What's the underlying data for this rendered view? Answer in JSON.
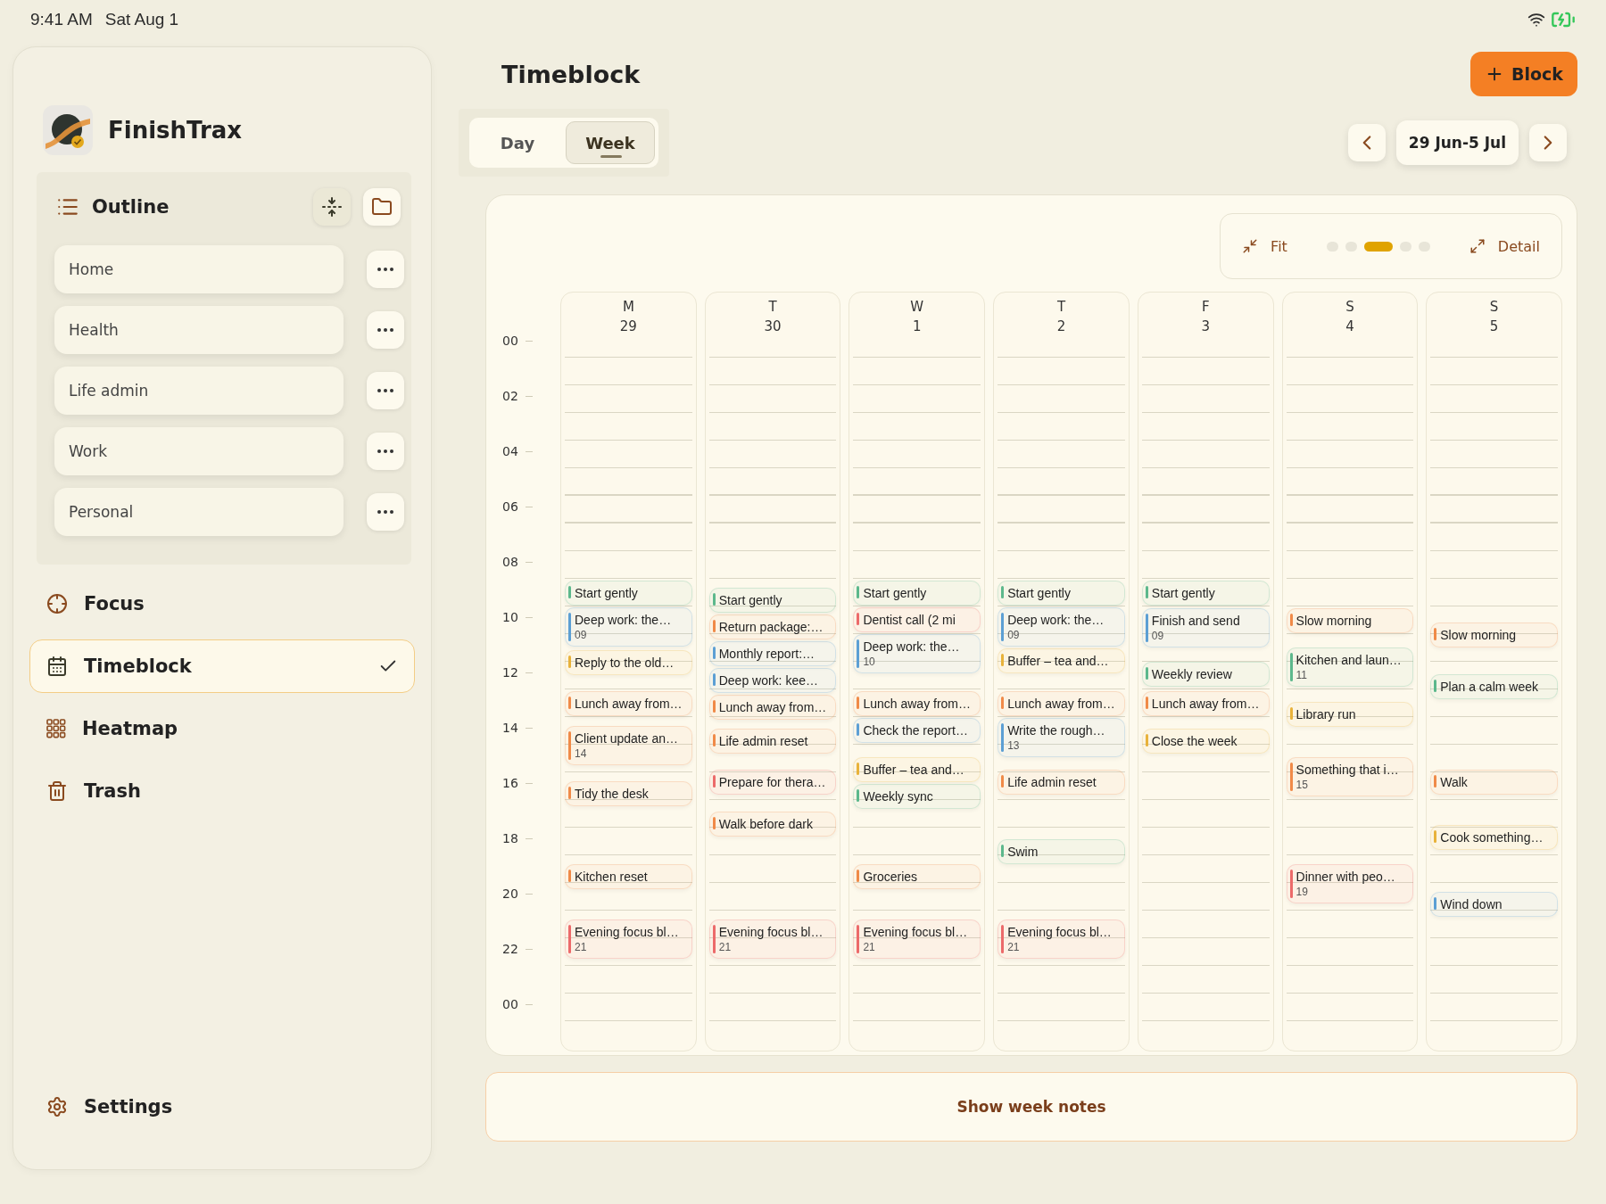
{
  "status_bar": {
    "time": "9:41 AM",
    "date": "Sat Aug 1"
  },
  "sidebar": {
    "app_name": "FinishTrax",
    "outline": {
      "title": "Outline",
      "items": [
        {
          "label": "Home"
        },
        {
          "label": "Health"
        },
        {
          "label": "Life admin"
        },
        {
          "label": "Work"
        },
        {
          "label": "Personal"
        }
      ]
    },
    "nav": [
      {
        "kind": "focus",
        "label": "Focus",
        "selected": false
      },
      {
        "kind": "timeblock",
        "label": "Timeblock",
        "selected": true
      },
      {
        "kind": "heatmap",
        "label": "Heatmap",
        "selected": false
      },
      {
        "kind": "trash",
        "label": "Trash",
        "selected": false
      }
    ],
    "settings": {
      "label": "Settings"
    }
  },
  "header": {
    "title": "Timeblock",
    "add_button": "Block"
  },
  "view_tabs": [
    {
      "label": "Day",
      "selected": false
    },
    {
      "label": "Week",
      "selected": true
    }
  ],
  "date_range": "29 Jun-5 Jul",
  "zoom": {
    "fit_label": "Fit",
    "detail_label": "Detail",
    "steps": [
      {
        "selected": false
      },
      {
        "selected": false
      },
      {
        "selected": true
      },
      {
        "selected": false
      },
      {
        "selected": false
      }
    ]
  },
  "hour_labels": [
    "00",
    "02",
    "04",
    "06",
    "08",
    "10",
    "12",
    "14",
    "16",
    "18",
    "20",
    "22",
    "00"
  ],
  "days": [
    {
      "letter": "M",
      "number": "29",
      "events": [
        {
          "title": "Start gently",
          "color": "#5cb88c"
        },
        {
          "title": "Deep work: the…",
          "sub": "09",
          "color": "#5c9fd4"
        },
        {
          "title": "Reply to the old…",
          "color": "#e8b23a"
        },
        {
          "title": "Lunch away from…",
          "color": "#f08a48"
        },
        {
          "title": "Client update an…",
          "sub": "14",
          "color": "#f08a48"
        },
        {
          "title": "Tidy the desk",
          "color": "#f08a48"
        },
        {
          "title": "Kitchen reset",
          "color": "#f08a48"
        },
        {
          "title": "Evening focus bl…",
          "sub": "21",
          "color": "#ec6a6a"
        }
      ]
    },
    {
      "letter": "T",
      "number": "30",
      "events": [
        {
          "title": "Start gently",
          "color": "#5cb88c"
        },
        {
          "title": "Return package:…",
          "color": "#f08a48"
        },
        {
          "title": "Monthly report:…",
          "color": "#5c9fd4"
        },
        {
          "title": "Deep work: kee…",
          "color": "#5c9fd4"
        },
        {
          "title": "Lunch away from…",
          "color": "#f08a48"
        },
        {
          "title": "Life admin reset",
          "color": "#f08a48"
        },
        {
          "title": "Prepare for thera…",
          "color": "#ec6a6a"
        },
        {
          "title": "Walk before dark",
          "color": "#f08a48"
        },
        {
          "title": "Evening focus bl…",
          "sub": "21",
          "color": "#ec6a6a"
        }
      ]
    },
    {
      "letter": "W",
      "number": "1",
      "events": [
        {
          "title": "Start gently",
          "color": "#5cb88c"
        },
        {
          "title": "Dentist call (2 mi",
          "color": "#ec6a6a"
        },
        {
          "title": "Deep work: the…",
          "sub": "10",
          "color": "#5c9fd4"
        },
        {
          "title": "Lunch away from…",
          "color": "#f08a48"
        },
        {
          "title": "Check the report…",
          "color": "#5c9fd4"
        },
        {
          "title": "Buffer – tea and…",
          "color": "#e8b23a"
        },
        {
          "title": "Weekly sync",
          "color": "#5cb88c"
        },
        {
          "title": "Groceries",
          "color": "#f08a48"
        },
        {
          "title": "Evening focus bl…",
          "sub": "21",
          "color": "#ec6a6a"
        }
      ]
    },
    {
      "letter": "T",
      "number": "2",
      "events": [
        {
          "title": "Start gently",
          "color": "#5cb88c"
        },
        {
          "title": "Deep work: the…",
          "sub": "09",
          "color": "#5c9fd4"
        },
        {
          "title": "Buffer – tea and…",
          "color": "#e8b23a"
        },
        {
          "title": "Lunch away from…",
          "color": "#f08a48"
        },
        {
          "title": "Write the rough…",
          "sub": "13",
          "color": "#5c9fd4"
        },
        {
          "title": "Life admin reset",
          "color": "#f08a48"
        },
        {
          "title": "Swim",
          "color": "#5cb88c"
        },
        {
          "title": "Evening focus bl…",
          "sub": "21",
          "color": "#ec6a6a"
        }
      ]
    },
    {
      "letter": "F",
      "number": "3",
      "events": [
        {
          "title": "Start gently",
          "color": "#5cb88c"
        },
        {
          "title": "Finish and send",
          "sub": "09",
          "color": "#5c9fd4"
        },
        {
          "title": "Weekly review",
          "color": "#5cb88c"
        },
        {
          "title": "Lunch away from…",
          "color": "#f08a48"
        },
        {
          "title": "Close the week",
          "color": "#e8b23a"
        }
      ]
    },
    {
      "letter": "S",
      "number": "4",
      "events": [
        {
          "title": "Slow morning",
          "color": "#f08a48"
        },
        {
          "title": "Kitchen and laun…",
          "sub": "11",
          "color": "#5cb88c"
        },
        {
          "title": "Library run",
          "color": "#e8b23a"
        },
        {
          "title": "Something that i…",
          "sub": "15",
          "color": "#f08a48"
        },
        {
          "title": "Dinner with peo…",
          "sub": "19",
          "color": "#ec6a6a"
        }
      ]
    },
    {
      "letter": "S",
      "number": "5",
      "events": [
        {
          "title": "Slow morning",
          "color": "#f08a48"
        },
        {
          "title": "Plan a calm week",
          "color": "#5cb88c"
        },
        {
          "title": "Walk",
          "color": "#f08a48"
        },
        {
          "title": "Cook something…",
          "color": "#e8b23a"
        },
        {
          "title": "Wind down",
          "color": "#5c9fd4"
        }
      ]
    }
  ],
  "week_notes_button": "Show week notes"
}
